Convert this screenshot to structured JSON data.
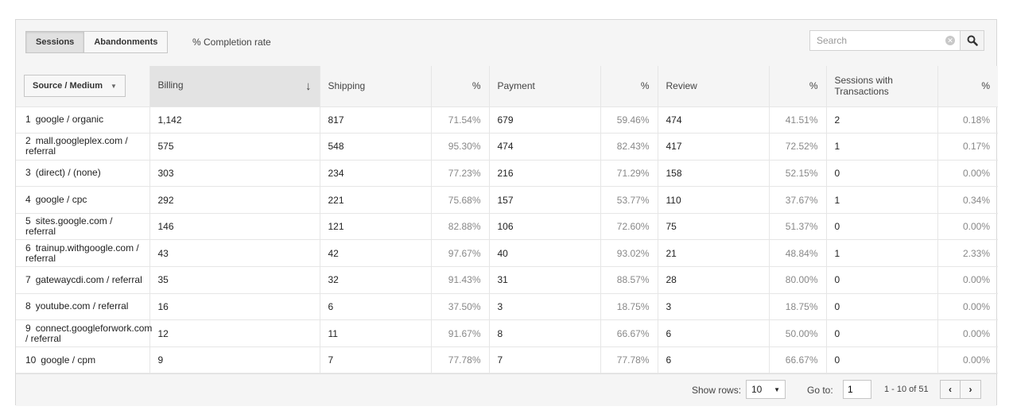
{
  "toolbar": {
    "tabs": [
      {
        "label": "Sessions",
        "active": true
      },
      {
        "label": "Abandonments",
        "active": false
      }
    ],
    "completion_label": "% Completion rate",
    "search": {
      "placeholder": "Search",
      "value": "",
      "clear_icon": "clear-circle-icon",
      "search_icon": "magnifier-icon"
    }
  },
  "table": {
    "columns": {
      "dimension": "Source / Medium",
      "billing": "Billing",
      "shipping": "Shipping",
      "shipping_pct": "%",
      "payment": "Payment",
      "payment_pct": "%",
      "review": "Review",
      "review_pct": "%",
      "transactions": "Sessions with Transactions",
      "transactions_pct": "%"
    },
    "sort_icon": "arrow-down-icon",
    "rows": [
      {
        "n": "1",
        "source": "google / organic",
        "billing": "1,142",
        "shipping": "817",
        "shipping_pct": "71.54%",
        "payment": "679",
        "payment_pct": "59.46%",
        "review": "474",
        "review_pct": "41.51%",
        "transactions": "2",
        "transactions_pct": "0.18%"
      },
      {
        "n": "2",
        "source": "mall.googleplex.com / referral",
        "billing": "575",
        "shipping": "548",
        "shipping_pct": "95.30%",
        "payment": "474",
        "payment_pct": "82.43%",
        "review": "417",
        "review_pct": "72.52%",
        "transactions": "1",
        "transactions_pct": "0.17%"
      },
      {
        "n": "3",
        "source": "(direct) / (none)",
        "billing": "303",
        "shipping": "234",
        "shipping_pct": "77.23%",
        "payment": "216",
        "payment_pct": "71.29%",
        "review": "158",
        "review_pct": "52.15%",
        "transactions": "0",
        "transactions_pct": "0.00%"
      },
      {
        "n": "4",
        "source": "google / cpc",
        "billing": "292",
        "shipping": "221",
        "shipping_pct": "75.68%",
        "payment": "157",
        "payment_pct": "53.77%",
        "review": "110",
        "review_pct": "37.67%",
        "transactions": "1",
        "transactions_pct": "0.34%"
      },
      {
        "n": "5",
        "source": "sites.google.com / referral",
        "billing": "146",
        "shipping": "121",
        "shipping_pct": "82.88%",
        "payment": "106",
        "payment_pct": "72.60%",
        "review": "75",
        "review_pct": "51.37%",
        "transactions": "0",
        "transactions_pct": "0.00%"
      },
      {
        "n": "6",
        "source": "trainup.withgoogle.com / referral",
        "billing": "43",
        "shipping": "42",
        "shipping_pct": "97.67%",
        "payment": "40",
        "payment_pct": "93.02%",
        "review": "21",
        "review_pct": "48.84%",
        "transactions": "1",
        "transactions_pct": "2.33%"
      },
      {
        "n": "7",
        "source": "gatewaycdi.com / referral",
        "billing": "35",
        "shipping": "32",
        "shipping_pct": "91.43%",
        "payment": "31",
        "payment_pct": "88.57%",
        "review": "28",
        "review_pct": "80.00%",
        "transactions": "0",
        "transactions_pct": "0.00%"
      },
      {
        "n": "8",
        "source": "youtube.com / referral",
        "billing": "16",
        "shipping": "6",
        "shipping_pct": "37.50%",
        "payment": "3",
        "payment_pct": "18.75%",
        "review": "3",
        "review_pct": "18.75%",
        "transactions": "0",
        "transactions_pct": "0.00%"
      },
      {
        "n": "9",
        "source": "connect.googleforwork.com / referral",
        "billing": "12",
        "shipping": "11",
        "shipping_pct": "91.67%",
        "payment": "8",
        "payment_pct": "66.67%",
        "review": "6",
        "review_pct": "50.00%",
        "transactions": "0",
        "transactions_pct": "0.00%"
      },
      {
        "n": "10",
        "source": "google / cpm",
        "billing": "9",
        "shipping": "7",
        "shipping_pct": "77.78%",
        "payment": "7",
        "payment_pct": "77.78%",
        "review": "6",
        "review_pct": "66.67%",
        "transactions": "0",
        "transactions_pct": "0.00%"
      }
    ]
  },
  "footer": {
    "show_rows_label": "Show rows:",
    "show_rows_value": "10",
    "goto_label": "Go to:",
    "goto_value": "1",
    "range": "1 - 10 of 51",
    "prev_icon": "chevron-left-icon",
    "next_icon": "chevron-right-icon"
  }
}
